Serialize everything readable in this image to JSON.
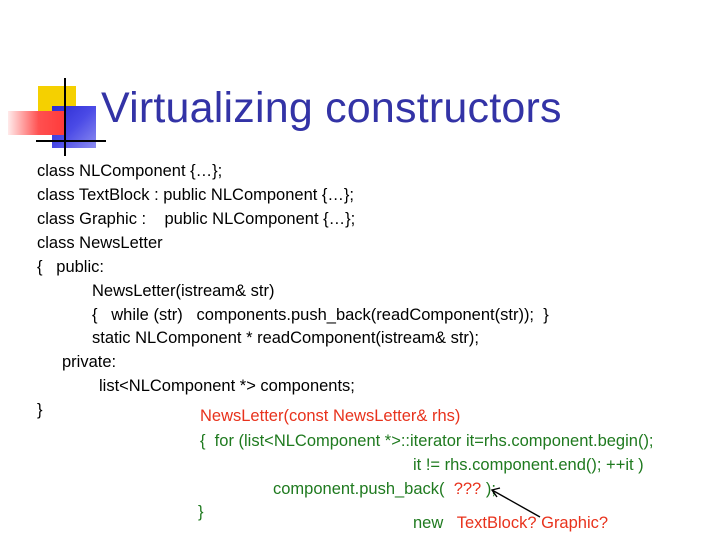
{
  "slide": {
    "title": "Virtualizing constructors",
    "code_lines": [
      "class NLComponent {…};",
      "class TextBlock : public NLComponent {…};",
      "class Graphic :    public NLComponent {…};",
      "class NewsLetter",
      "{   public:",
      "NewsLetter(istream& str)",
      "{   while (str)   components.push_back(readComponent(str));  }",
      "static NLComponent * readComponent(istream& str);",
      "private:",
      "list<NLComponent *> components;",
      "}"
    ],
    "copy_ctor": {
      "signature": "NewsLetter(const NewsLetter& rhs)",
      "for_line": "{  for (list<NLComponent *>::iterator it=rhs.component.begin();",
      "cond_line": "it != rhs.component.end(); ++it )",
      "push_prefix": "component.push_back(  ",
      "push_placeholder": "???",
      "push_suffix": " );",
      "close_brace": "}",
      "note_prefix": "new   ",
      "note_red": "TextBlock? Graphic?"
    }
  }
}
